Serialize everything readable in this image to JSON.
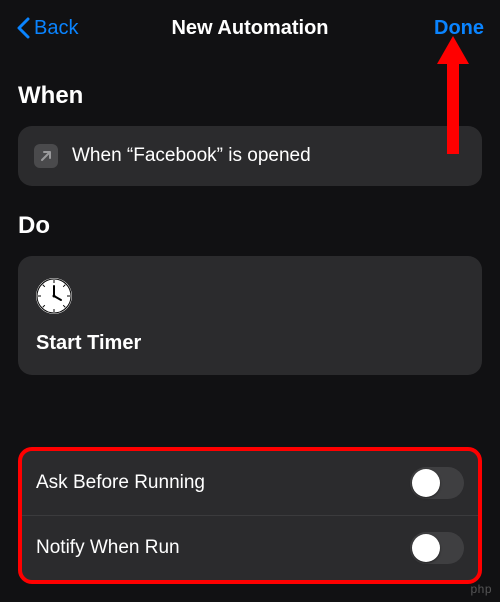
{
  "header": {
    "back_label": "Back",
    "title": "New Automation",
    "done_label": "Done"
  },
  "sections": {
    "when_label": "When",
    "do_label": "Do"
  },
  "when": {
    "trigger_text": "When “Facebook” is opened"
  },
  "do": {
    "action_title": "Start Timer"
  },
  "options": {
    "ask_label": "Ask Before Running",
    "notify_label": "Notify When Run",
    "ask_on": false,
    "notify_on": false
  },
  "colors": {
    "accent": "#0a84ff",
    "card": "#2b2b2d",
    "bg": "#111113",
    "annotation": "#ff0000"
  },
  "icons": {
    "back": "chevron-left-icon",
    "open": "open-app-icon",
    "clock": "clock-icon"
  },
  "watermark": "php"
}
